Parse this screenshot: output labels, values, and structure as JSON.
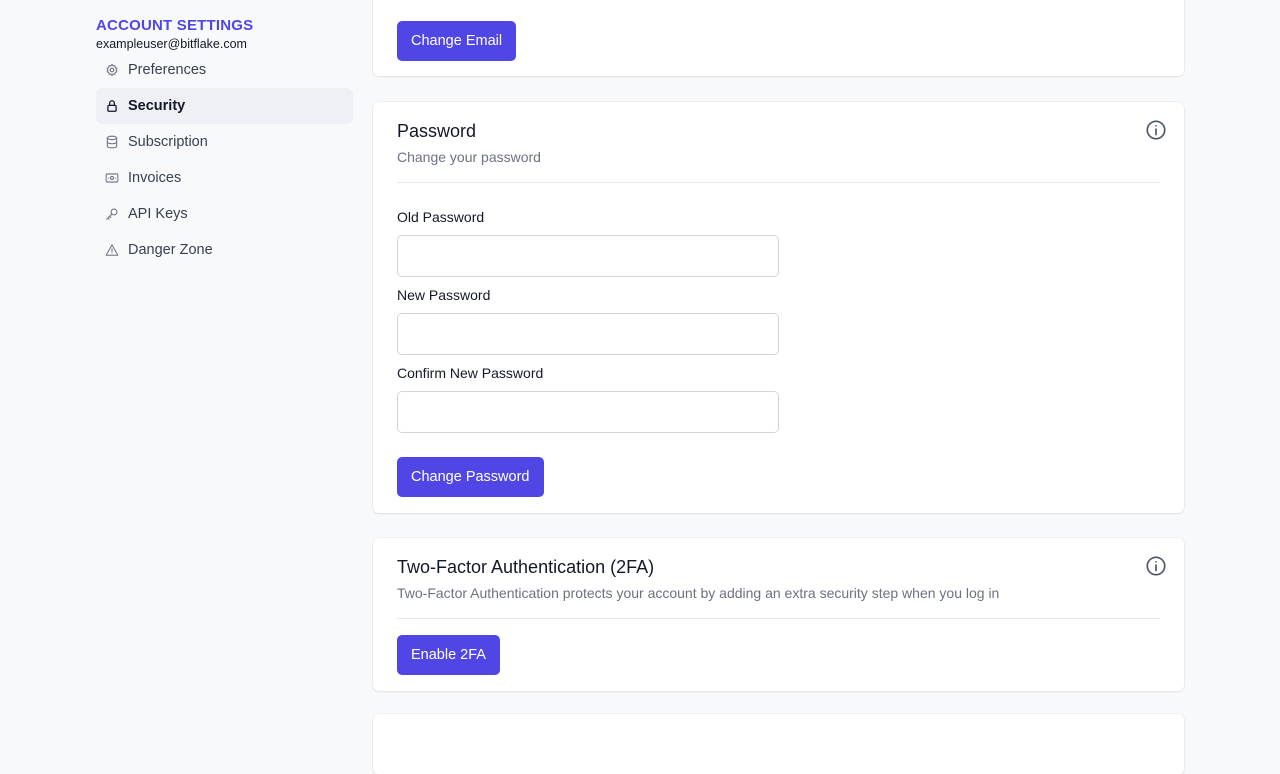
{
  "sidebar": {
    "heading": "ACCOUNT SETTINGS",
    "email": "exampleuser@bitflake.com",
    "items": [
      {
        "label": "Preferences",
        "icon": "gear-icon",
        "active": false
      },
      {
        "label": "Security",
        "icon": "lock-icon",
        "active": true
      },
      {
        "label": "Subscription",
        "icon": "database-icon",
        "active": false
      },
      {
        "label": "Invoices",
        "icon": "banknote-icon",
        "active": false
      },
      {
        "label": "API Keys",
        "icon": "key-icon",
        "active": false
      },
      {
        "label": "Danger Zone",
        "icon": "warning-icon",
        "active": false
      }
    ]
  },
  "email_card": {
    "button_label": "Change Email"
  },
  "password_card": {
    "title": "Password",
    "description": "Change your password",
    "old_label": "Old Password",
    "old_value": "",
    "new_label": "New Password",
    "new_value": "",
    "confirm_label": "Confirm New Password",
    "confirm_value": "",
    "button_label": "Change Password"
  },
  "twofa_card": {
    "title": "Two-Factor Authentication (2FA)",
    "description": "Two-Factor Authentication protects your account by adding an extra security step when you log in",
    "button_label": "Enable 2FA"
  },
  "colors": {
    "accent": "#4f46e5",
    "background": "#f8f9fb",
    "active_nav_bg": "#eef0f5",
    "muted_text": "#6b7280"
  }
}
